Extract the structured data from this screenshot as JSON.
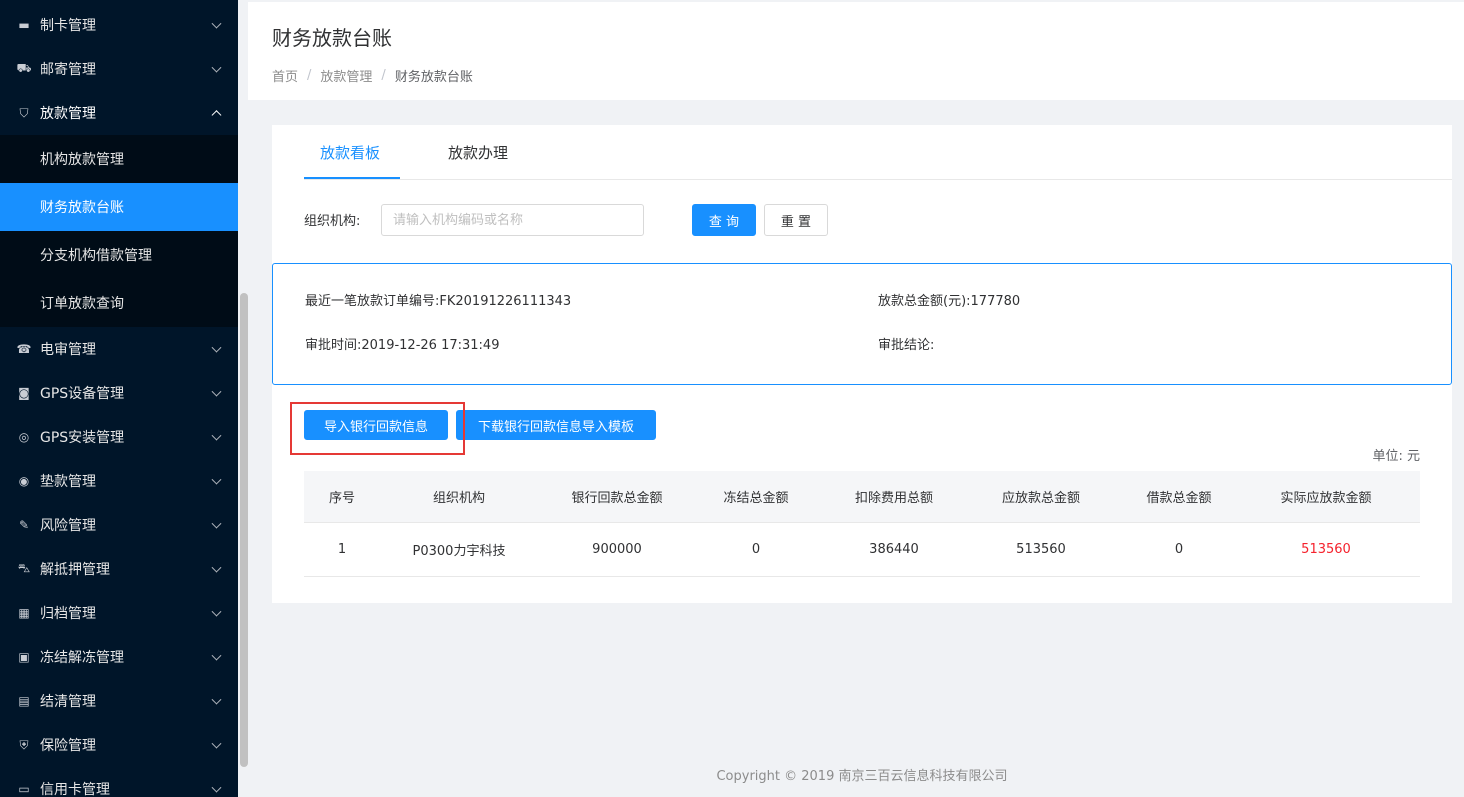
{
  "sidebar": {
    "items": [
      {
        "label": "制卡管理",
        "icon": "card-icon"
      },
      {
        "label": "邮寄管理",
        "icon": "truck-icon"
      },
      {
        "label": "放款管理",
        "icon": "loan-icon",
        "open": true,
        "children": [
          {
            "label": "机构放款管理"
          },
          {
            "label": "财务放款台账",
            "active": true
          },
          {
            "label": "分支机构借款管理"
          },
          {
            "label": "订单放款查询"
          }
        ]
      },
      {
        "label": "电审管理",
        "icon": "phone-icon"
      },
      {
        "label": "GPS设备管理",
        "icon": "gps-device-icon"
      },
      {
        "label": "GPS安装管理",
        "icon": "target-icon"
      },
      {
        "label": "垫款管理",
        "icon": "coin-icon"
      },
      {
        "label": "风险管理",
        "icon": "risk-icon"
      },
      {
        "label": "解抵押管理",
        "icon": "car-icon"
      },
      {
        "label": "归档管理",
        "icon": "archive-icon"
      },
      {
        "label": "冻结解冻管理",
        "icon": "image-icon"
      },
      {
        "label": "结清管理",
        "icon": "settle-icon"
      },
      {
        "label": "保险管理",
        "icon": "shield-icon"
      },
      {
        "label": "信用卡管理",
        "icon": "credit-card-icon"
      }
    ]
  },
  "header": {
    "title": "财务放款台账",
    "breadcrumb": [
      "首页",
      "放款管理",
      "财务放款台账"
    ]
  },
  "tabs": [
    "放款看板",
    "放款办理"
  ],
  "filter": {
    "label": "组织机构:",
    "placeholder": "请输入机构编码或名称",
    "query_label": "查 询",
    "reset_label": "重 置"
  },
  "info": {
    "order_no_label": "最近一笔放款订单编号:",
    "order_no": "FK20191226111343",
    "total_label": "放款总金额(元):",
    "total": "177780",
    "approve_time_label": "审批时间:",
    "approve_time": "2019-12-26 17:31:49",
    "conclusion_label": "审批结论:",
    "conclusion": ""
  },
  "actions": {
    "import_label": "导入银行回款信息",
    "download_label": "下载银行回款信息导入模板"
  },
  "unit": "单位: 元",
  "table": {
    "headers": [
      "序号",
      "组织机构",
      "银行回款总金额",
      "冻结总金额",
      "扣除费用总额",
      "应放款总金额",
      "借款总金额",
      "实际应放款金额"
    ],
    "rows": [
      [
        "1",
        "P0300力宇科技",
        "900000",
        "0",
        "386440",
        "513560",
        "0",
        "513560"
      ]
    ]
  },
  "footer": "Copyright © 2019 南京三百云信息科技有限公司",
  "colors": {
    "primary": "#1890ff",
    "sidebar": "#001529",
    "highlight": "#e53935",
    "danger": "#f5222d"
  }
}
